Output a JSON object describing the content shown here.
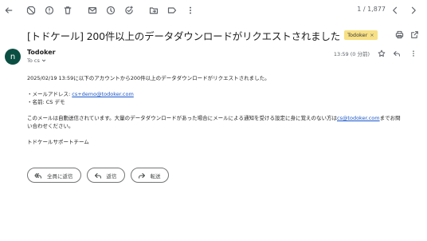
{
  "toolbar": {
    "icons": [
      "back-arrow-icon",
      "report-spam-icon",
      "info-icon",
      "delete-icon",
      "mark-unread-icon",
      "snooze-icon",
      "add-task-icon",
      "move-to-icon",
      "label-icon",
      "more-vert-icon"
    ],
    "pager": "1 / 1,877"
  },
  "email": {
    "subject": "[トドケール] 200件以上のデータダウンロードがリクエストされました",
    "label": "Todoker",
    "label_remove": "×",
    "avatar_initial": "n",
    "sender": "Todoker",
    "to": "To cs",
    "time": "13:59 (0 分前)",
    "body": {
      "line1": "2025/02/19 13:59に以下のアカウントから200件以上のデータダウンロードがリクエストされました。",
      "mail_prefix": "・メールアドレス: ",
      "mail_link": "cs+demo@todoker.com",
      "name_line": "・名前: CS デモ",
      "notice_prefix": "このメールは自動送信されています。大量のデータダウンロードがあった場合にメールによる通知を受ける設定に身に覚えのない方は",
      "notice_link": "cs@todoker.com",
      "notice_suffix": "までお問",
      "notice_line2": "い合わせください。",
      "signature": "トドケールサポートチーム"
    }
  },
  "actions": {
    "reply_all": "全員に返信",
    "reply": "返信",
    "forward": "転送"
  }
}
